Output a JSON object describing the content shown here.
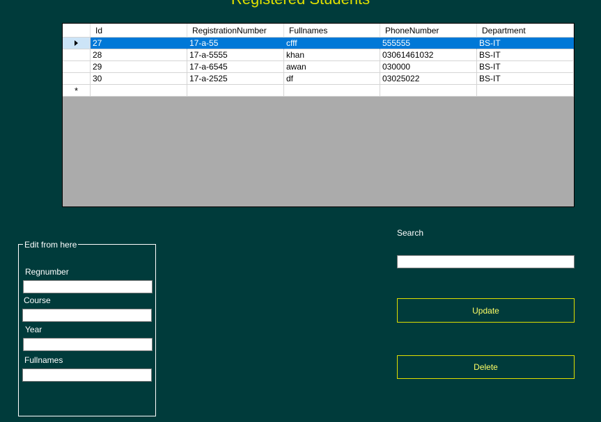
{
  "title": "Registered Students",
  "grid": {
    "columns": [
      "Id",
      "RegistrationNumber",
      "Fullnames",
      "PhoneNumber",
      "Department"
    ],
    "rows": [
      [
        "27",
        "17-a-55",
        "cfff",
        "555555",
        "BS-IT"
      ],
      [
        "28",
        "17-a-5555",
        "khan",
        "03061461032",
        "BS-IT"
      ],
      [
        "29",
        "17-a-6545",
        "awan",
        "030000",
        "BS-IT"
      ],
      [
        "30",
        "17-a-2525",
        "df",
        "03025022",
        "BS-IT"
      ]
    ],
    "new_row_marker": "*"
  },
  "edit_group": {
    "legend": "Edit from here",
    "regnumber_label": "Regnumber",
    "regnumber_value": "",
    "course_label": "Course",
    "course_value": "",
    "year_label": "Year",
    "year_value": "",
    "fullnames_label": "Fullnames",
    "fullnames_value": ""
  },
  "search": {
    "label": "Search",
    "value": ""
  },
  "buttons": {
    "update_label": "Update",
    "delete_label": "Delete"
  },
  "colors": {
    "background": "#003b3b",
    "title": "#e0e000",
    "selection": "#0078d7",
    "button_border": "#e0e000",
    "button_text": "#ffff66"
  }
}
